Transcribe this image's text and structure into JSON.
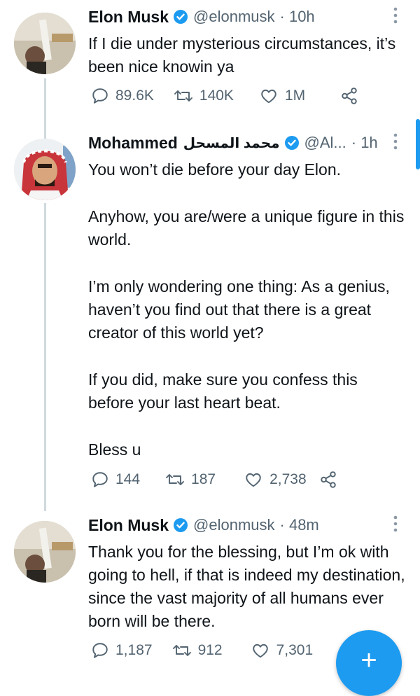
{
  "tweets": [
    {
      "name": "Elon Musk",
      "handle": "@elonmusk",
      "time": "· 10h",
      "paragraphs": [
        "If I die under mysterious circumstances, it’s been nice knowin ya"
      ],
      "replies": "89.6K",
      "retweets": "140K",
      "likes": "1M"
    },
    {
      "name": "Mohammed",
      "name_arabic": "محمد المسحل",
      "handle": "@Al...",
      "time": "· 1h",
      "paragraphs": [
        "You won’t die before your day Elon.",
        "Anyhow, you are/were a unique figure in this world.",
        "I’m only wondering one thing: As a genius, haven’t you find out that there is a great creator of this world yet?",
        "If you did, make sure you confess this before your last heart beat.",
        "Bless u"
      ],
      "replies": "144",
      "retweets": "187",
      "likes": "2,738"
    },
    {
      "name": "Elon Musk",
      "handle": "@elonmusk",
      "time": "· 48m",
      "paragraphs": [
        "Thank you for the blessing, but I’m ok with going to hell, if that is indeed my destination, since the vast majority of all humans ever born will be there."
      ],
      "replies": "1,187",
      "retweets": "912",
      "likes": "7,301"
    }
  ],
  "fab": {
    "label": "+"
  },
  "colors": {
    "accent": "#1d9bf0",
    "muted": "#536471",
    "text": "#0f1419",
    "thread_line": "#cfd9de"
  }
}
